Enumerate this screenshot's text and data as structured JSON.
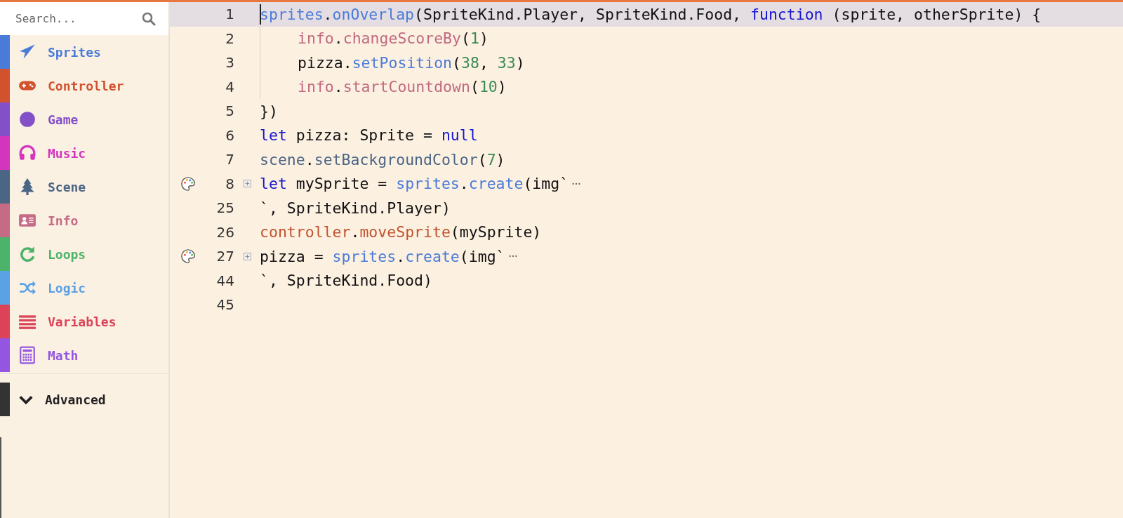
{
  "search": {
    "placeholder": "Search..."
  },
  "categories": [
    {
      "label": "Sprites",
      "kind": "plane",
      "color": "#4b7bd8",
      "selected": false
    },
    {
      "label": "Controller",
      "kind": "gamepad",
      "color": "#d2522e",
      "selected": false
    },
    {
      "label": "Game",
      "kind": "circle",
      "color": "#8350c8",
      "selected": false
    },
    {
      "label": "Music",
      "kind": "headphones",
      "color": "#d336bd",
      "selected": false
    },
    {
      "label": "Scene",
      "kind": "tree",
      "color": "#4b6584",
      "selected": false
    },
    {
      "label": "Info",
      "kind": "card",
      "color": "#c56b85",
      "selected": false
    },
    {
      "label": "Loops",
      "kind": "loop",
      "color": "#4cb36b",
      "selected": false
    },
    {
      "label": "Logic",
      "kind": "shuffle",
      "color": "#5ba1e5",
      "selected": false
    },
    {
      "label": "Variables",
      "kind": "bars",
      "color": "#dc4358",
      "selected": false
    },
    {
      "label": "Math",
      "kind": "calculator",
      "color": "#9456e0",
      "selected": false
    }
  ],
  "advanced": {
    "label": "Advanced",
    "expanded": false
  },
  "code_lines": [
    {
      "number": "1",
      "current": true,
      "folded": false,
      "indent": false,
      "tokens": [
        {
          "t": "sprites",
          "kind": "sprites"
        },
        {
          "t": ".",
          "kind": "plain"
        },
        {
          "t": "onOverlap",
          "kind": "sprites"
        },
        {
          "t": "(SpriteKind.Player, SpriteKind.Food, ",
          "kind": "plain"
        },
        {
          "t": "function",
          "kind": "keyword"
        },
        {
          "t": " (sprite, otherSprite) {",
          "kind": "plain"
        }
      ]
    },
    {
      "number": "2",
      "current": false,
      "folded": false,
      "indent": true,
      "tokens": [
        {
          "t": "info",
          "kind": "info"
        },
        {
          "t": ".",
          "kind": "plain"
        },
        {
          "t": "changeScoreBy",
          "kind": "info"
        },
        {
          "t": "(",
          "kind": "plain"
        },
        {
          "t": "1",
          "kind": "number"
        },
        {
          "t": ")",
          "kind": "plain"
        }
      ]
    },
    {
      "number": "3",
      "current": false,
      "folded": false,
      "indent": true,
      "tokens": [
        {
          "t": "pizza.",
          "kind": "plain"
        },
        {
          "t": "setPosition",
          "kind": "sprites"
        },
        {
          "t": "(",
          "kind": "plain"
        },
        {
          "t": "38",
          "kind": "number"
        },
        {
          "t": ", ",
          "kind": "plain"
        },
        {
          "t": "33",
          "kind": "number"
        },
        {
          "t": ")",
          "kind": "plain"
        }
      ]
    },
    {
      "number": "4",
      "current": false,
      "folded": false,
      "indent": true,
      "tokens": [
        {
          "t": "info",
          "kind": "info"
        },
        {
          "t": ".",
          "kind": "plain"
        },
        {
          "t": "startCountdown",
          "kind": "info"
        },
        {
          "t": "(",
          "kind": "plain"
        },
        {
          "t": "10",
          "kind": "number"
        },
        {
          "t": ")",
          "kind": "plain"
        }
      ]
    },
    {
      "number": "5",
      "current": false,
      "folded": false,
      "indent": false,
      "tokens": [
        {
          "t": "})",
          "kind": "plain"
        }
      ]
    },
    {
      "number": "6",
      "current": false,
      "folded": false,
      "indent": false,
      "tokens": [
        {
          "t": "let",
          "kind": "keyword"
        },
        {
          "t": " pizza: Sprite = ",
          "kind": "plain"
        },
        {
          "t": "null",
          "kind": "keyword"
        }
      ]
    },
    {
      "number": "7",
      "current": false,
      "folded": false,
      "indent": false,
      "tokens": [
        {
          "t": "scene",
          "kind": "scene"
        },
        {
          "t": ".",
          "kind": "plain"
        },
        {
          "t": "setBackgroundColor",
          "kind": "scene"
        },
        {
          "t": "(",
          "kind": "plain"
        },
        {
          "t": "7",
          "kind": "number"
        },
        {
          "t": ")",
          "kind": "plain"
        }
      ]
    },
    {
      "number": "8",
      "current": false,
      "folded": true,
      "indent": false,
      "tokens": [
        {
          "t": "let",
          "kind": "keyword"
        },
        {
          "t": " mySprite = ",
          "kind": "plain"
        },
        {
          "t": "sprites",
          "kind": "sprites"
        },
        {
          "t": ".",
          "kind": "plain"
        },
        {
          "t": "create",
          "kind": "sprites"
        },
        {
          "t": "(img`",
          "kind": "plain"
        }
      ]
    },
    {
      "number": "25",
      "current": false,
      "folded": false,
      "indent": false,
      "tokens": [
        {
          "t": "`, SpriteKind.Player)",
          "kind": "plain"
        }
      ]
    },
    {
      "number": "26",
      "current": false,
      "folded": false,
      "indent": false,
      "tokens": [
        {
          "t": "controller",
          "kind": "controller"
        },
        {
          "t": ".",
          "kind": "plain"
        },
        {
          "t": "moveSprite",
          "kind": "controller"
        },
        {
          "t": "(mySprite)",
          "kind": "plain"
        }
      ]
    },
    {
      "number": "27",
      "current": false,
      "folded": true,
      "indent": false,
      "tokens": [
        {
          "t": "pizza = ",
          "kind": "plain"
        },
        {
          "t": "sprites",
          "kind": "sprites"
        },
        {
          "t": ".",
          "kind": "plain"
        },
        {
          "t": "create",
          "kind": "sprites"
        },
        {
          "t": "(img`",
          "kind": "plain"
        }
      ]
    },
    {
      "number": "44",
      "current": false,
      "folded": false,
      "indent": false,
      "tokens": [
        {
          "t": "`, SpriteKind.Food)",
          "kind": "plain"
        }
      ]
    },
    {
      "number": "45",
      "current": false,
      "folded": false,
      "indent": false
    }
  ]
}
